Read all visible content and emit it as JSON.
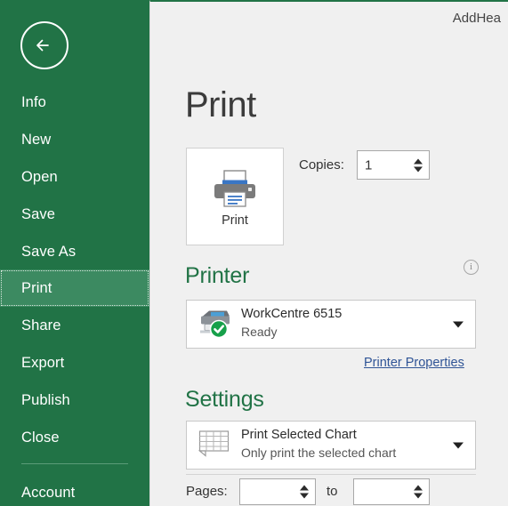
{
  "window": {
    "title": "AddHea"
  },
  "sidebar": {
    "back_icon": "back-arrow-icon",
    "items": [
      {
        "label": "Info",
        "active": false
      },
      {
        "label": "New",
        "active": false
      },
      {
        "label": "Open",
        "active": false
      },
      {
        "label": "Save",
        "active": false
      },
      {
        "label": "Save As",
        "active": false
      },
      {
        "label": "Print",
        "active": true
      },
      {
        "label": "Share",
        "active": false
      },
      {
        "label": "Export",
        "active": false
      },
      {
        "label": "Publish",
        "active": false
      },
      {
        "label": "Close",
        "active": false
      },
      {
        "label": "Account",
        "active": false
      }
    ]
  },
  "main": {
    "page_title": "Print",
    "print_button": {
      "label": "Print",
      "icon": "printer-icon"
    },
    "copies": {
      "label": "Copies:",
      "value": "1"
    },
    "printer": {
      "heading": "Printer",
      "info_icon": "info-icon",
      "name": "WorkCentre 6515",
      "status": "Ready",
      "icon": "printer-device-icon",
      "properties_link": "Printer Properties"
    },
    "settings": {
      "heading": "Settings",
      "scope_name": "Print Selected Chart",
      "scope_desc": "Only print the selected chart",
      "icon": "worksheet-grid-icon",
      "pages_label": "Pages:",
      "pages_from": "",
      "pages_to": "",
      "to_label": "to"
    }
  },
  "colors": {
    "brand_green": "#217346",
    "sidebar_active": "#3c8a61",
    "link_blue": "#2f5496",
    "status_green": "#17a04a",
    "panel_bg": "#f0f0f0"
  }
}
